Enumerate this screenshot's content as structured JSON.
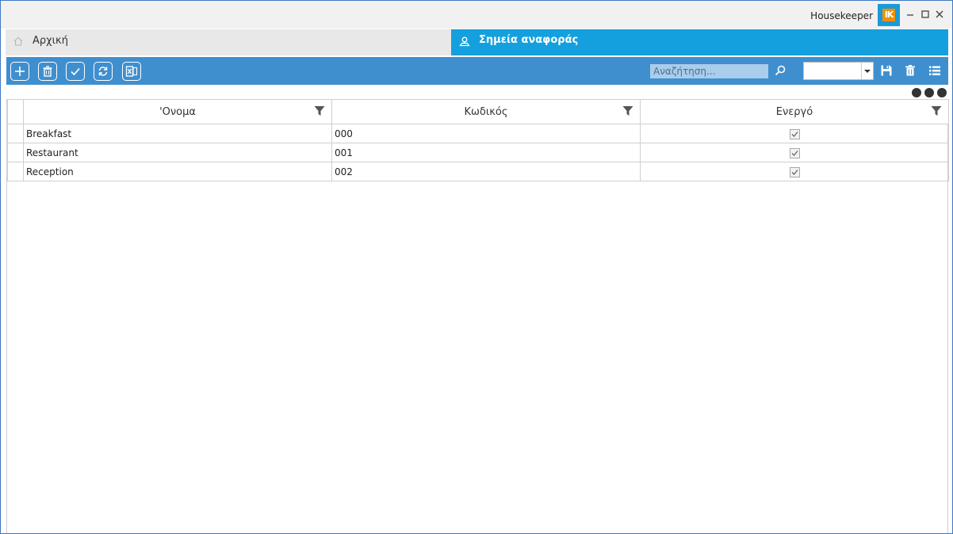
{
  "window": {
    "app_title": "Housekeeper",
    "logo_text": "IK",
    "minimize": "–",
    "maximize": "□",
    "close": "✕"
  },
  "tabs": [
    {
      "label": "Αρχική",
      "icon": "home-icon",
      "active": false
    },
    {
      "label": "Σημεία αναφοράς",
      "icon": "map-pin-icon",
      "active": true
    }
  ],
  "toolbar": {
    "buttons": [
      "add-icon",
      "delete-icon",
      "check-icon",
      "refresh-icon",
      "excel-icon"
    ],
    "search_placeholder": "Αναζήτηση...",
    "select_value": "",
    "right_icons": [
      "save-icon",
      "trash-icon",
      "list-icon"
    ]
  },
  "grid": {
    "columns": [
      "'Ονομα",
      "Κωδικός",
      "Ενεργό"
    ],
    "rows": [
      {
        "name": "Breakfast",
        "code": "000",
        "active": true
      },
      {
        "name": "Restaurant",
        "code": "001",
        "active": true
      },
      {
        "name": "Reception",
        "code": "002",
        "active": true
      }
    ]
  },
  "colors": {
    "accent": "#14a0de",
    "toolbar": "#3f8fcf",
    "logo_orange": "#f29100"
  }
}
